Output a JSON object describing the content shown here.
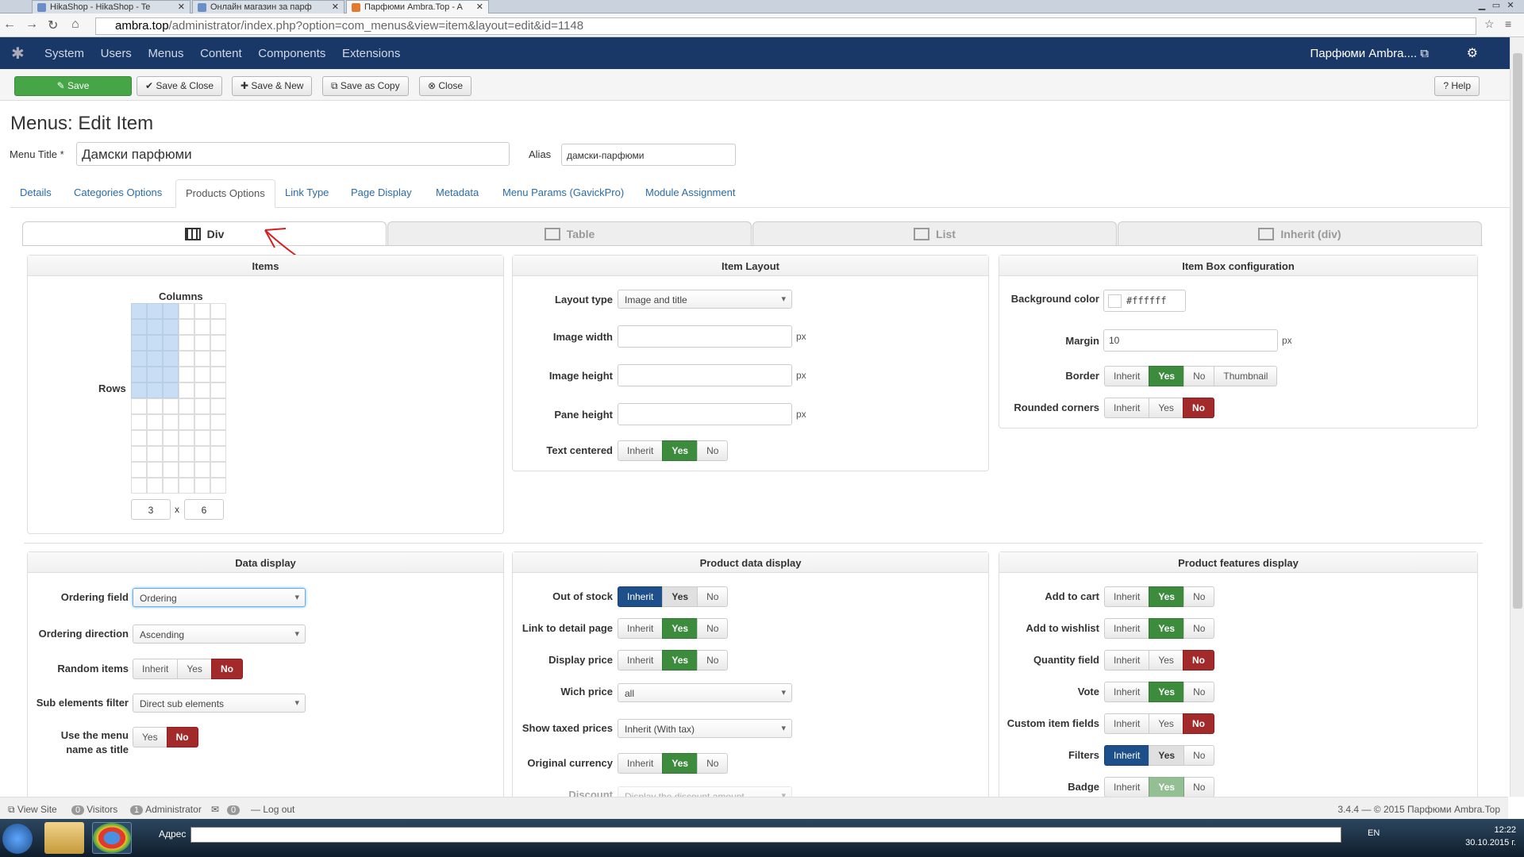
{
  "browser": {
    "tabs": [
      "HikaShop - HikaShop - Te",
      "Онлайн магазин за парф",
      "Парфюми Ambra.Top - A"
    ],
    "url_host": "ambra.top",
    "url_rest": "/administrator/index.php?option=com_menus&view=item&layout=edit&id=1148"
  },
  "topnav": {
    "menu": [
      "System",
      "Users",
      "Menus",
      "Content",
      "Components",
      "Extensions"
    ],
    "site_name": "Парфюми Ambra.... ⧉"
  },
  "toolbar": {
    "save": "✎  Save",
    "save_close": "✔  Save & Close",
    "save_new": "✚  Save & New",
    "save_copy": "⧉  Save as Copy",
    "close": "⊗  Close",
    "help": "?  Help"
  },
  "page": {
    "title": "Menus: Edit Item",
    "menu_title_label": "Menu Title *",
    "menu_title_value": "Дамски парфюми",
    "alias_label": "Alias",
    "alias_value": "дамски-парфюми"
  },
  "tabs": [
    "Details",
    "Categories Options",
    "Products Options",
    "Link Type",
    "Page Display",
    "Metadata",
    "Menu Params (GavickPro)",
    "Module Assignment"
  ],
  "layout_tabs": [
    "Div",
    "Table",
    "List",
    "Inherit (div)"
  ],
  "items_panel": {
    "title": "Items",
    "columns_label": "Columns",
    "rows_label": "Rows",
    "columns_value": "3",
    "x": "x",
    "rows_value": "6"
  },
  "item_layout": {
    "title": "Item Layout",
    "layout_type_label": "Layout type",
    "layout_type_value": "Image and title",
    "image_width_label": "Image width",
    "image_height_label": "Image height",
    "pane_height_label": "Pane height",
    "px": "px",
    "text_centered_label": "Text centered"
  },
  "item_box": {
    "title": "Item Box configuration",
    "bg_label": "Background color",
    "bg_value": "#ffffff",
    "margin_label": "Margin",
    "margin_value": "10",
    "border_label": "Border",
    "rounded_label": "Rounded corners"
  },
  "opts": {
    "inherit": "Inherit",
    "yes": "Yes",
    "no": "No",
    "thumbnail": "Thumbnail"
  },
  "data_display": {
    "title": "Data display",
    "ordering_field_label": "Ordering field",
    "ordering_field_value": "Ordering",
    "ordering_direction_label": "Ordering direction",
    "ordering_direction_value": "Ascending",
    "random_label": "Random items",
    "sub_filter_label": "Sub elements filter",
    "sub_filter_value": "Direct sub elements",
    "use_menu_label_1": "Use the menu",
    "use_menu_label_2": "name as title"
  },
  "product_data": {
    "title": "Product data display",
    "out_of_stock": "Out of stock",
    "link_detail": "Link to detail page",
    "display_price": "Display price",
    "wich_price": "Wich price",
    "wich_price_value": "all",
    "taxed_prices": "Show taxed prices",
    "taxed_prices_value": "Inherit (With tax)",
    "orig_currency": "Original currency",
    "discount": "Discount",
    "discount_value": "Display the discount amount"
  },
  "product_features": {
    "title": "Product features display",
    "add_to_cart": "Add to cart",
    "add_to_wishlist": "Add to wishlist",
    "quantity_field": "Quantity field",
    "vote": "Vote",
    "custom_fields": "Custom item fields",
    "filters": "Filters",
    "badge": "Badge"
  },
  "status": {
    "view_site": "View Site",
    "visitors_count": "0",
    "visitors": "Visitors",
    "admin_count": "1",
    "administrator": "Administrator",
    "msg_count": "0",
    "logout": "Log out",
    "version": "3.4.4 — © 2015 Парфюми Ambra.Top"
  },
  "taskbar": {
    "address_label": "Адрес",
    "lang": "EN",
    "time": "12:22",
    "date": "30.10.2015 г."
  }
}
